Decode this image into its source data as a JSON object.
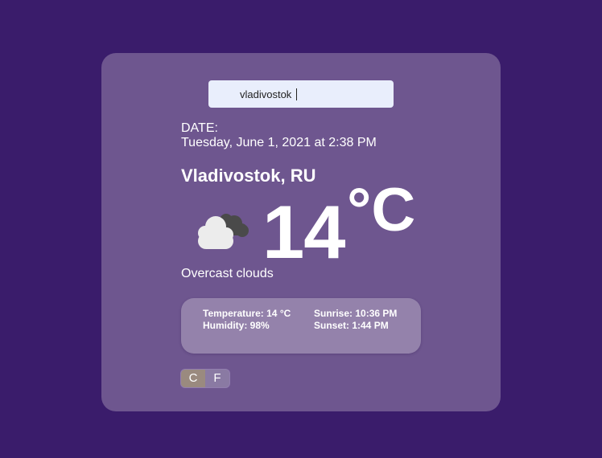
{
  "search": {
    "value": "vladivostok"
  },
  "date": {
    "label": "DATE:",
    "value": "Tuesday, June 1, 2021 at 2:38 PM"
  },
  "location": {
    "city": "Vladivostok, RU"
  },
  "current": {
    "icon": "overcast-clouds-icon",
    "temperature": "14",
    "unit": "°C",
    "description": "Overcast clouds"
  },
  "details": {
    "temperature": "Temperature: 14 °C",
    "humidity": "Humidity: 98%",
    "sunrise": "Sunrise: 10:36 PM",
    "sunset": "Sunset: 1:44 PM"
  },
  "unit_toggle": {
    "celsius_label": "C",
    "fahrenheit_label": "F",
    "active": "C"
  },
  "colors": {
    "background": "#3a1c6b",
    "card": "#6e568f",
    "details_panel": "#9482ab",
    "search_field": "#e9eefc"
  }
}
